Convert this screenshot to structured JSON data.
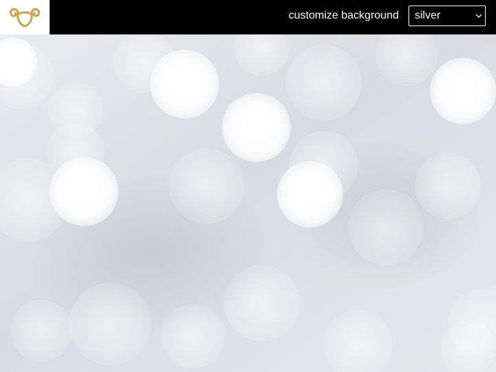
{
  "header": {
    "logo_icon": "ram-horns-logo-icon",
    "logo_color": "#c9a24a",
    "customize_label": "customize background",
    "background_select": {
      "selected": "silver",
      "chevron_icon": "chevron-down-icon"
    }
  },
  "background": {
    "theme": "silver",
    "style": "bokeh"
  }
}
